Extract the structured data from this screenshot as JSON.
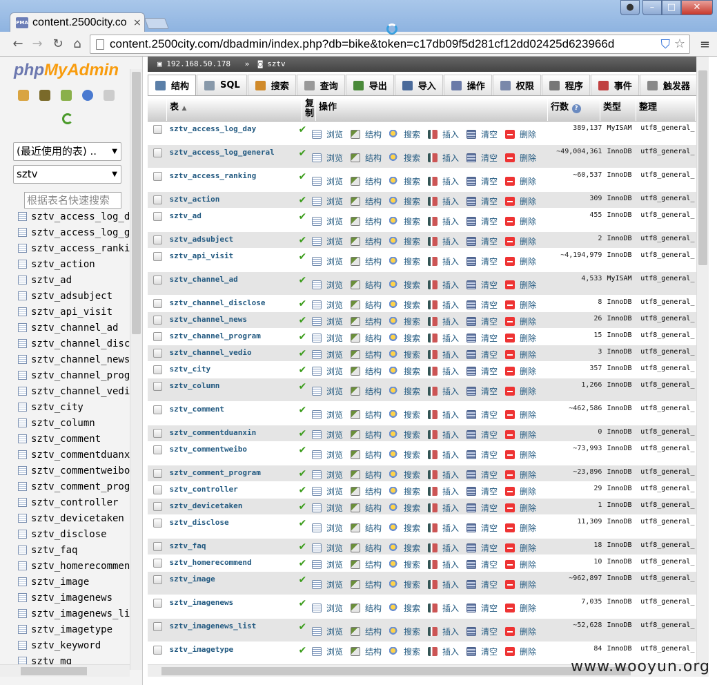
{
  "browser": {
    "tab_title": "content.2500city.co",
    "tab_close": "×",
    "favicon_text": "PMA",
    "url": "content.2500city.com/dbadmin/index.php?db=bike&token=c17db09f5d281cf12dd02425d623966d",
    "back": "←",
    "forward": "→",
    "reload": "↻",
    "home": "⌂",
    "menu": "≡",
    "star": "☆",
    "shield": "⛉"
  },
  "sidebar": {
    "logo_php": "php",
    "logo_myadmin": "MyAdmin",
    "recent_select": "(最近使用的表) ..",
    "db_select": "sztv",
    "filter_placeholder": "根据表名快速搜索",
    "items": [
      "sztv_access_log_day",
      "sztv_access_log_general",
      "sztv_access_ranking",
      "sztv_action",
      "sztv_ad",
      "sztv_adsubject",
      "sztv_api_visit",
      "sztv_channel_ad",
      "sztv_channel_disclose",
      "sztv_channel_news",
      "sztv_channel_program",
      "sztv_channel_vedio",
      "sztv_city",
      "sztv_column",
      "sztv_comment",
      "sztv_commentduanxin",
      "sztv_commentweibo",
      "sztv_comment_program",
      "sztv_controller",
      "sztv_devicetaken",
      "sztv_disclose",
      "sztv_faq",
      "sztv_homerecommend",
      "sztv_image",
      "sztv_imagenews",
      "sztv_imagenews_list",
      "sztv_imagetype",
      "sztv_keyword",
      "sztv_mq"
    ]
  },
  "breadcrumb": {
    "server": "192.168.50.178",
    "sep": "»",
    "db": "sztv"
  },
  "tabs": [
    {
      "label": "结构",
      "color": "#5b7fa8"
    },
    {
      "label": "SQL",
      "color": "#8899aa"
    },
    {
      "label": "搜索",
      "color": "#d08a2a"
    },
    {
      "label": "查询",
      "color": "#999999"
    },
    {
      "label": "导出",
      "color": "#4a8a3a"
    },
    {
      "label": "导入",
      "color": "#4a6a9a"
    },
    {
      "label": "操作",
      "color": "#6a7aa8"
    },
    {
      "label": "权限",
      "color": "#7a88aa"
    },
    {
      "label": "程序",
      "color": "#777777"
    },
    {
      "label": "事件",
      "color": "#c04040"
    },
    {
      "label": "触发器",
      "color": "#888888"
    }
  ],
  "table_header": {
    "table": "表",
    "sort": "▲",
    "replicate": "复制",
    "actions": "操作",
    "rows": "行数",
    "type": "类型",
    "collation": "整理",
    "help": "?"
  },
  "actions": [
    "浏览",
    "结构",
    "搜索",
    "插入",
    "清空",
    "删除"
  ],
  "rows": [
    {
      "name": "sztv_access_log_day",
      "rows": "389,137",
      "type": "MyISAM",
      "collation": "utf8_general_",
      "h": 34
    },
    {
      "name": "sztv_access_log_general",
      "rows": "~49,004,361",
      "type": "InnoDB",
      "collation": "utf8_general_",
      "h": 34
    },
    {
      "name": "sztv_access_ranking",
      "rows": "~60,537",
      "type": "InnoDB",
      "collation": "utf8_general_",
      "h": 34
    },
    {
      "name": "sztv_action",
      "rows": "309",
      "type": "InnoDB",
      "collation": "utf8_general_",
      "h": 24
    },
    {
      "name": "sztv_ad",
      "rows": "455",
      "type": "InnoDB",
      "collation": "utf8_general_",
      "h": 34
    },
    {
      "name": "sztv_adsubject",
      "rows": "2",
      "type": "InnoDB",
      "collation": "utf8_general_",
      "h": 24
    },
    {
      "name": "sztv_api_visit",
      "rows": "~4,194,979",
      "type": "InnoDB",
      "collation": "utf8_general_",
      "h": 34
    },
    {
      "name": "sztv_channel_ad",
      "rows": "4,533",
      "type": "MyISAM",
      "collation": "utf8_general_",
      "h": 34
    },
    {
      "name": "sztv_channel_disclose",
      "rows": "8",
      "type": "InnoDB",
      "collation": "utf8_general_",
      "h": 24
    },
    {
      "name": "sztv_channel_news",
      "rows": "26",
      "type": "InnoDB",
      "collation": "utf8_general_",
      "h": 24
    },
    {
      "name": "sztv_channel_program",
      "rows": "15",
      "type": "InnoDB",
      "collation": "utf8_general_",
      "h": 24
    },
    {
      "name": "sztv_channel_vedio",
      "rows": "3",
      "type": "InnoDB",
      "collation": "utf8_general_",
      "h": 24
    },
    {
      "name": "sztv_city",
      "rows": "357",
      "type": "InnoDB",
      "collation": "utf8_general_",
      "h": 24
    },
    {
      "name": "sztv_column",
      "rows": "1,266",
      "type": "InnoDB",
      "collation": "utf8_general_",
      "h": 34
    },
    {
      "name": "sztv_comment",
      "rows": "~462,586",
      "type": "InnoDB",
      "collation": "utf8_general_",
      "h": 34
    },
    {
      "name": "sztv_commentduanxin",
      "rows": "0",
      "type": "InnoDB",
      "collation": "utf8_general_",
      "h": 24
    },
    {
      "name": "sztv_commentweibo",
      "rows": "~73,993",
      "type": "InnoDB",
      "collation": "utf8_general_",
      "h": 34
    },
    {
      "name": "sztv_comment_program",
      "rows": "~23,896",
      "type": "InnoDB",
      "collation": "utf8_general_",
      "h": 24
    },
    {
      "name": "sztv_controller",
      "rows": "29",
      "type": "InnoDB",
      "collation": "utf8_general_",
      "h": 24
    },
    {
      "name": "sztv_devicetaken",
      "rows": "1",
      "type": "InnoDB",
      "collation": "utf8_general_",
      "h": 24
    },
    {
      "name": "sztv_disclose",
      "rows": "11,309",
      "type": "InnoDB",
      "collation": "utf8_general_",
      "h": 34
    },
    {
      "name": "sztv_faq",
      "rows": "18",
      "type": "InnoDB",
      "collation": "utf8_general_",
      "h": 24
    },
    {
      "name": "sztv_homerecommend",
      "rows": "10",
      "type": "InnoDB",
      "collation": "utf8_general_",
      "h": 24
    },
    {
      "name": "sztv_image",
      "rows": "~962,897",
      "type": "InnoDB",
      "collation": "utf8_general_",
      "h": 34
    },
    {
      "name": "sztv_imagenews",
      "rows": "7,035",
      "type": "InnoDB",
      "collation": "utf8_general_",
      "h": 34
    },
    {
      "name": "sztv_imagenews_list",
      "rows": "~52,628",
      "type": "InnoDB",
      "collation": "utf8_general_",
      "h": 34
    },
    {
      "name": "sztv_imagetype",
      "rows": "84",
      "type": "InnoDB",
      "collation": "utf8_general_",
      "h": 24
    }
  ],
  "watermark": "www.wooyun.org"
}
